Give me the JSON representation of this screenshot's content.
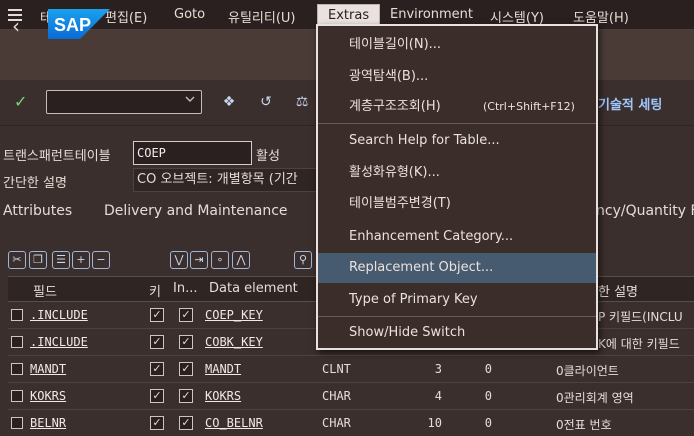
{
  "menubar": {
    "items": [
      "테이블",
      "편집(E)",
      "Goto",
      "유틸리티(U)",
      "Extras",
      "Environment",
      "시스템(Y)",
      "도움말(H)"
    ]
  },
  "toolbar": {
    "tech_settings": "기술적 세팅"
  },
  "fields": {
    "transparent_table_label": "트랜스패런트테이블",
    "transparent_table_value": "COEP",
    "active_label": "활성",
    "short_desc_label": "간단한 설명",
    "short_desc_value": "CO 오브젝트: 개별항목 (기간"
  },
  "tabs": [
    "Attributes",
    "Delivery and Maintenance",
    "ncy/Quantity F"
  ],
  "table": {
    "headers": [
      "필드",
      "키",
      "In...",
      "Data element",
      "한 설명"
    ],
    "rows": [
      {
        "field": ".INCLUDE",
        "de": "COEP_KEY",
        "type": "",
        "len": "",
        "dec": "",
        "desc": "P 키필드(INCLU"
      },
      {
        "field": ".INCLUDE",
        "de": "COBK_KEY",
        "type": "",
        "len": "",
        "dec": "",
        "desc": "K에 대한 키필드"
      },
      {
        "field": "MANDT",
        "de": "MANDT",
        "type": "CLNT",
        "len": "3",
        "dec": "0",
        "desc": "0클라이언트"
      },
      {
        "field": "KOKRS",
        "de": "KOKRS",
        "type": "CHAR",
        "len": "4",
        "dec": "0",
        "desc": "0관리회계 영역"
      },
      {
        "field": "BELNR",
        "de": "CO_BELNR",
        "type": "CHAR",
        "len": "10",
        "dec": "0",
        "desc": "0전표 번호"
      }
    ]
  },
  "dropdown": {
    "items": [
      {
        "label": "테이블길이(N)...",
        "shortcut": ""
      },
      {
        "label": "광역탐색(B)...",
        "shortcut": ""
      },
      {
        "label": "계층구조조회(H)",
        "shortcut": "(Ctrl+Shift+F12)"
      },
      {
        "label": "Search Help for Table...",
        "shortcut": ""
      },
      {
        "label": "활성화유형(K)...",
        "shortcut": ""
      },
      {
        "label": "테이블범주변경(T)",
        "shortcut": ""
      },
      {
        "label": "Enhancement Category...",
        "shortcut": ""
      },
      {
        "label": "Replacement Object...",
        "shortcut": ""
      },
      {
        "label": "Type of Primary Key",
        "shortcut": ""
      },
      {
        "label": "Show/Hide Switch",
        "shortcut": ""
      }
    ]
  },
  "colors": {
    "background": "#3b2f2d",
    "menubar": "#2a201f",
    "highlight": "#465a70",
    "accent_blue": "#9fc7ff"
  }
}
